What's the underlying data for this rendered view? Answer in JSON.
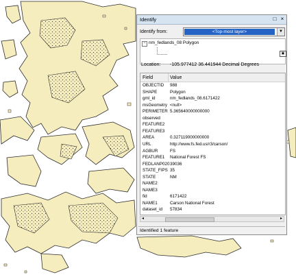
{
  "window": {
    "title": "Identify",
    "close_glyph": "×",
    "restore_glyph": "□"
  },
  "identify_from": {
    "label": "Identify from:",
    "value": "<Top-most layer>",
    "arrow_icon": "chevron-down-icon"
  },
  "tree": {
    "layer_name": "nm_fedlands_08 Polygon",
    "expander": "⊟"
  },
  "location": {
    "label": "Location:",
    "value": "-105.977412  36.441944 Decimal Degrees"
  },
  "grid": {
    "headers": {
      "field": "Field",
      "value": "Value"
    },
    "rows": [
      {
        "field": "OBJECTID",
        "value": "988"
      },
      {
        "field": "SHAPE",
        "value": "Polygon"
      },
      {
        "field": "gml_id",
        "value": "nm_fedlands_08.6171422"
      },
      {
        "field": "msGeometry",
        "value": "<null>"
      },
      {
        "field": "PERIMETER",
        "value": "5.365640000000000"
      },
      {
        "field": "observed",
        "value": ""
      },
      {
        "field": "FEATURE2",
        "value": ""
      },
      {
        "field": "FEATURE3",
        "value": ""
      },
      {
        "field": "AREA",
        "value": "0.327119000000000"
      },
      {
        "field": "URL",
        "value": "http://www.fs.fed.us/r3/carson/"
      },
      {
        "field": "AGBUR",
        "value": "FS"
      },
      {
        "field": "FEATURE1",
        "value": "National Forest FS"
      },
      {
        "field": "FEDLANP020",
        "value": "39036"
      },
      {
        "field": "STATE_FIPS",
        "value": "35"
      },
      {
        "field": "STATE",
        "value": "NM"
      },
      {
        "field": "NAME2",
        "value": ""
      },
      {
        "field": "NAME3",
        "value": ""
      },
      {
        "field": "fid",
        "value": "6171422"
      },
      {
        "field": "NAME1",
        "value": "Carson National Forest"
      },
      {
        "field": "dataset_id",
        "value": "57834"
      }
    ]
  },
  "status": {
    "text": "Identified 1 feature"
  },
  "colors": {
    "land_fill": "#f6edbf",
    "land_stroke": "#2a2a2a",
    "titlebar": "#d6e3f1",
    "selection": "#2563c4"
  }
}
